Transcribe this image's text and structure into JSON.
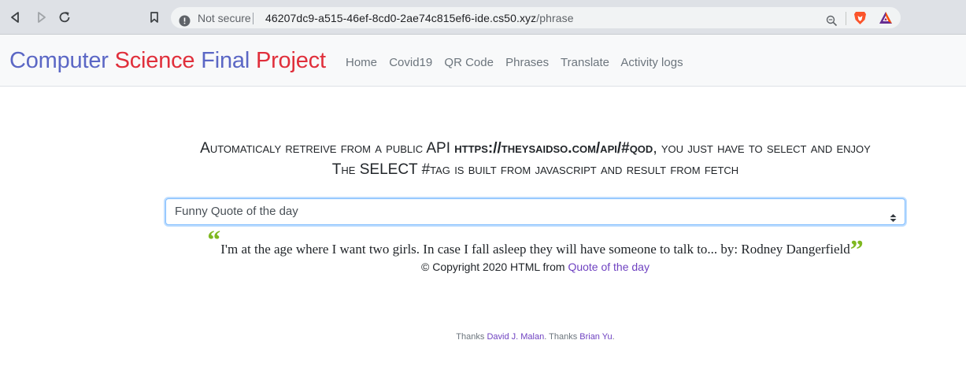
{
  "browser": {
    "security_label": "Not secure",
    "url_host": "46207dc9-a515-46ef-8cd0-2ae74c815ef6-ide.cs50.xyz",
    "url_path": "/phrase"
  },
  "navbar": {
    "brand": [
      "Computer",
      "Science",
      "Final",
      "Project"
    ],
    "brand_colors": {
      "blue": "#5b67c5",
      "red": "#e02f3b"
    },
    "links": [
      "Home",
      "Covid19",
      "QR Code",
      "Phrases",
      "Translate",
      "Activity logs"
    ]
  },
  "main": {
    "heading_line1_prefix": "Automaticaly retreive from a public API ",
    "heading_line1_url": "https://theysaidso.com/api/#qod",
    "heading_line1_suffix": ", you just have to select and enjoy",
    "heading_line2": "The SELECT #tag is built from javascript and result from fetch",
    "select_value": "Funny Quote of the day",
    "quote_text": "I'm at the age where I want two girls. In case I fall asleep they will have someone to talk to... by: Rodney Dangerfield",
    "open_quote": "“",
    "close_quote": "”",
    "quote_mark_color": "#7fb820",
    "copyright_prefix": "© Copyright 2020 HTML from ",
    "copyright_link": "Quote of the day"
  },
  "footer": {
    "thanks1": "Thanks ",
    "name1": "David J. Malan",
    "thanks2": ". Thanks ",
    "name2": "Brian Yu",
    "end": "."
  }
}
